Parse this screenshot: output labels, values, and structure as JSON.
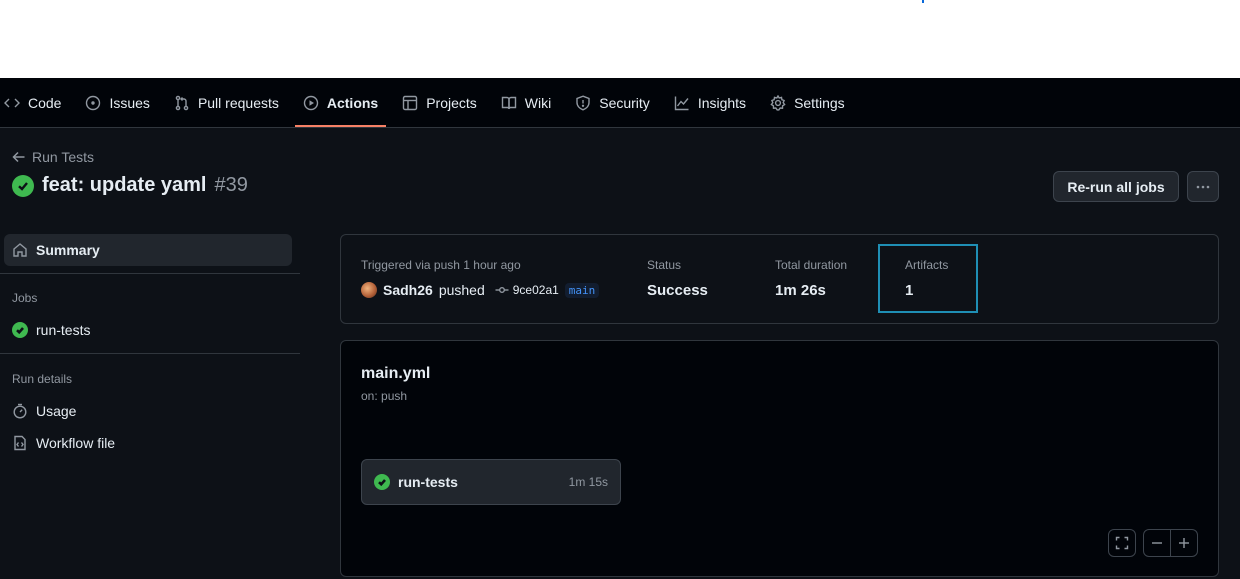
{
  "repo_nav": {
    "items": [
      {
        "label": "Code",
        "icon": "code-icon"
      },
      {
        "label": "Issues",
        "icon": "issue-icon"
      },
      {
        "label": "Pull requests",
        "icon": "pull-request-icon"
      },
      {
        "label": "Actions",
        "icon": "play-icon",
        "active": true
      },
      {
        "label": "Projects",
        "icon": "table-icon"
      },
      {
        "label": "Wiki",
        "icon": "book-icon"
      },
      {
        "label": "Security",
        "icon": "shield-icon"
      },
      {
        "label": "Insights",
        "icon": "graph-icon"
      },
      {
        "label": "Settings",
        "icon": "gear-icon"
      }
    ]
  },
  "header": {
    "back_label": "Run Tests",
    "run_title": "feat: update yaml",
    "run_number": "#39",
    "rerun_label": "Re-run all jobs"
  },
  "sidebar": {
    "summary_label": "Summary",
    "jobs_heading": "Jobs",
    "job_label": "run-tests",
    "run_details_heading": "Run details",
    "usage_label": "Usage",
    "workflow_file_label": "Workflow file"
  },
  "summary": {
    "trigger_label": "Triggered via push 1 hour ago",
    "actor": "Sadh26",
    "action": "pushed",
    "commit": "9ce02a1",
    "branch": "main",
    "status_label": "Status",
    "status_value": "Success",
    "duration_label": "Total duration",
    "duration_value": "1m 26s",
    "artifacts_label": "Artifacts",
    "artifacts_value": "1"
  },
  "graph": {
    "workflow_name": "main.yml",
    "workflow_trigger": "on: push",
    "job_name": "run-tests",
    "job_duration": "1m 15s"
  },
  "colors": {
    "success": "#3fb950",
    "active_tab_underline": "#f78166",
    "highlight_border": "#1f8fb5"
  }
}
